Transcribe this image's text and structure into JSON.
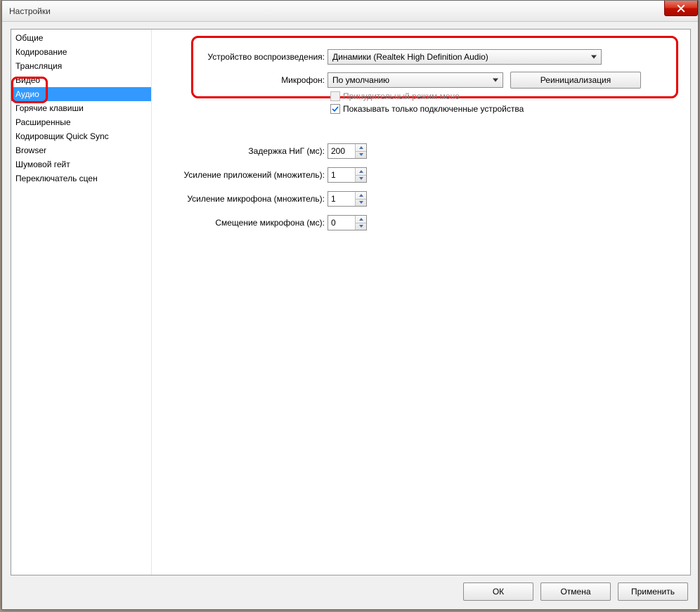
{
  "window": {
    "title": "Настройки"
  },
  "sidebar": {
    "items": [
      {
        "label": "Общие"
      },
      {
        "label": "Кодирование"
      },
      {
        "label": "Трансляция"
      },
      {
        "label": "Видео"
      },
      {
        "label": "Аудио"
      },
      {
        "label": "Горячие клавиши"
      },
      {
        "label": "Расширенные"
      },
      {
        "label": "Кодировщик Quick Sync"
      },
      {
        "label": "Browser"
      },
      {
        "label": "Шумовой гейт"
      },
      {
        "label": "Переключатель сцен"
      }
    ],
    "selected_index": 4
  },
  "form": {
    "playback_label": "Устройство воспроизведения:",
    "playback_value": "Динамики (Realtek High Definition Audio)",
    "mic_label": "Микрофон:",
    "mic_value": "По умолчанию",
    "reinit_btn": "Реинициализация",
    "force_mono": {
      "label": "Принудительный режим моно",
      "checked": false,
      "disabled": true
    },
    "show_connected": {
      "label": "Показывать только подключенные устройства",
      "checked": true,
      "disabled": false
    },
    "delay_label": "Задержка НиГ (мс):",
    "delay_value": "200",
    "app_gain_label": "Усиление приложений (множитель):",
    "app_gain_value": "1",
    "mic_gain_label": "Усиление микрофона (множитель):",
    "mic_gain_value": "1",
    "mic_offset_label": "Смещение микрофона (мс):",
    "mic_offset_value": "0"
  },
  "buttons": {
    "ok": "ОК",
    "cancel": "Отмена",
    "apply": "Применить"
  }
}
